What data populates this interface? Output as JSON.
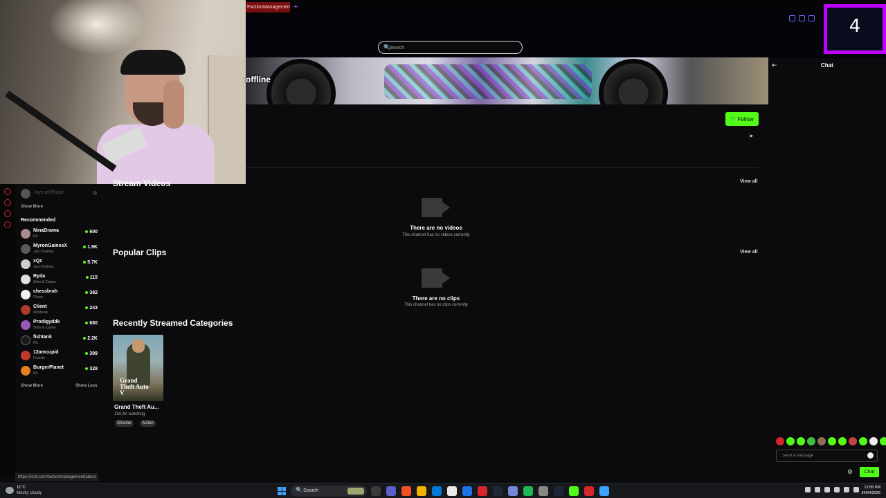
{
  "browser": {
    "tab_title": "FactionManagement Stre",
    "new_tab": "+"
  },
  "search": {
    "placeholder": "Search"
  },
  "banner": {
    "offline_label": "offline"
  },
  "channel": {
    "follow_label": "Follow"
  },
  "sidebar": {
    "following": [
      {
        "name": "JayzuzOfficial"
      }
    ],
    "show_more_top": "Show More",
    "recommended_heading": "Recommended",
    "recommended": [
      {
        "name": "NinaDrama",
        "category": "IRL",
        "viewers": "600"
      },
      {
        "name": "MyronGainesX",
        "category": "Just Chatting",
        "viewers": "1.9K"
      },
      {
        "name": "xQc",
        "category": "Just Chatting",
        "viewers": "5.7K"
      },
      {
        "name": "Ryda",
        "category": "Slots & Casino",
        "viewers": "115"
      },
      {
        "name": "chessbrah",
        "category": "Chess",
        "viewers": "382"
      },
      {
        "name": "Client",
        "category": "Windrose",
        "viewers": "243"
      },
      {
        "name": "Prodigyddk",
        "category": "Slots & Casino",
        "viewers": "680"
      },
      {
        "name": "fishtank",
        "category": "IRL",
        "viewers": "2.2K"
      },
      {
        "name": "12amcupid",
        "category": "Fortnite",
        "viewers": "399"
      },
      {
        "name": "BurgerPlanet",
        "category": "IRL",
        "viewers": "328"
      }
    ],
    "show_more_bottom": "Show More",
    "show_less": "Show Less"
  },
  "sections": {
    "videos": {
      "title": "Stream Videos",
      "view_all": "View all",
      "empty_title": "There are no videos",
      "empty_sub": "This channel has no videos currently"
    },
    "clips": {
      "title": "Popular Clips",
      "view_all": "View all",
      "empty_title": "There are no clips",
      "empty_sub": "This channel has no clips currently"
    },
    "categories": {
      "title": "Recently Streamed Categories",
      "items": [
        {
          "name": "Grand Theft Au...",
          "watching": "150.4K watching",
          "tags": [
            "Shooter",
            "Action"
          ],
          "logo_text": "Grand Theft Auto V"
        }
      ]
    }
  },
  "chat": {
    "title": "Chat",
    "input_placeholder": "Send a message",
    "send_label": "Chat",
    "emote_colors": [
      "#d4262c",
      "#53fc18",
      "#53fc18",
      "#3fbf3f",
      "#8a6d5b",
      "#53fc18",
      "#53fc18",
      "#c84040",
      "#53fc18",
      "#eeeeee",
      "#53fc18",
      "#53fc18",
      "#e6c07a"
    ]
  },
  "overlay": {
    "counter": "4"
  },
  "status_bar": {
    "url": "https://kick.com/factionmanagement/about"
  },
  "taskbar": {
    "weather_temp": "11°C",
    "weather_desc": "Mostly cloudy",
    "search_label": "Search",
    "time": "12:55 PM",
    "date": "24/04/2026",
    "app_colors": [
      "#3a3a3a",
      "#5b5fc7",
      "#f25022",
      "#f2b300",
      "#0078d4",
      "#e8e8e8",
      "#1a73e8",
      "#d4262c",
      "#1b2838",
      "#7289da",
      "#1db954",
      "#888888",
      "#1b2838",
      "#53fc18",
      "#d4262c",
      "#3ea1ff"
    ]
  },
  "colors": {
    "accent_green": "#53fc18",
    "overlay_border": "#c000ff",
    "background": "#0b0b0d"
  }
}
